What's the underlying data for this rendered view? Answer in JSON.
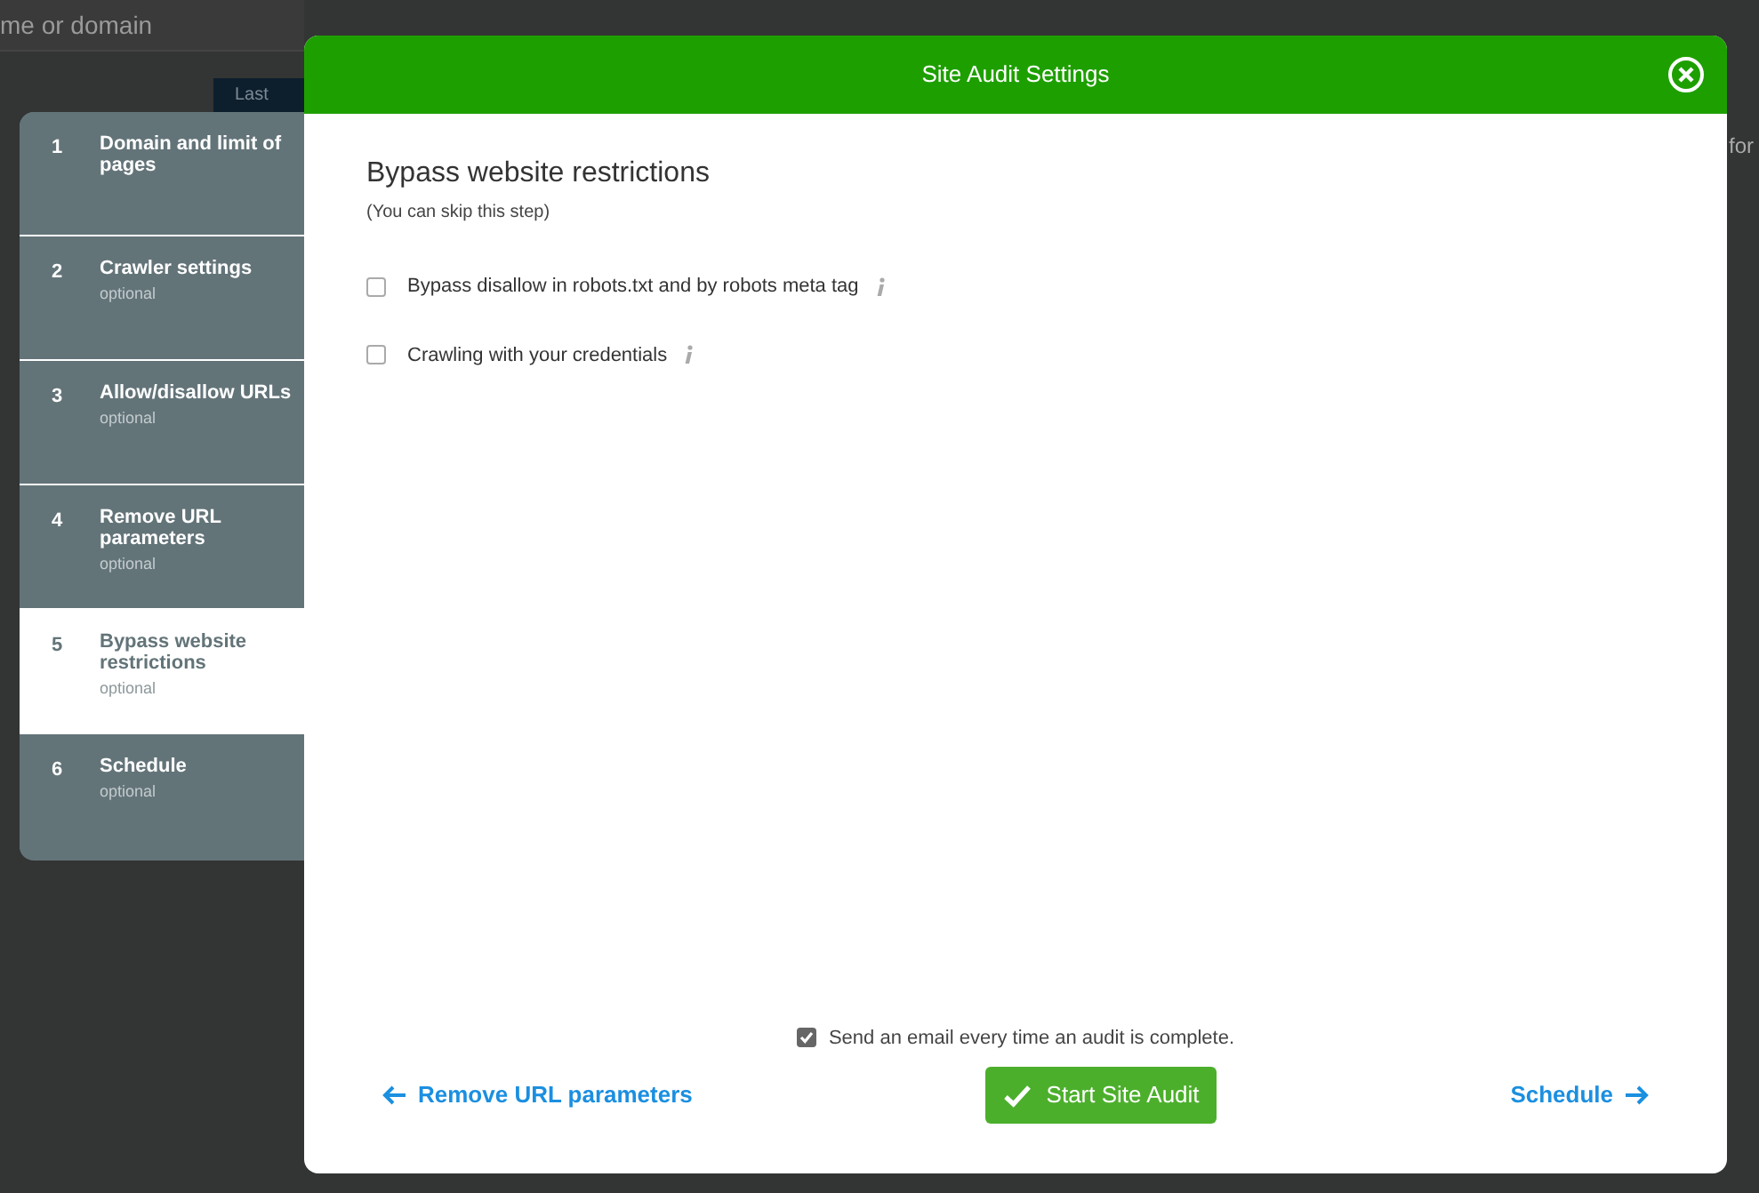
{
  "background": {
    "search_text": "me or domain",
    "button": "Last",
    "right_text": "for"
  },
  "steps": [
    {
      "number": "1",
      "title": "Domain and limit of pages",
      "selected": false
    },
    {
      "number": "2",
      "title": "Crawler settings",
      "note": "optional",
      "selected": false
    },
    {
      "number": "3",
      "title": "Allow/disallow URLs",
      "note": "optional",
      "selected": false
    },
    {
      "number": "4",
      "title": "Remove URL parameters",
      "note": "optional",
      "selected": false
    },
    {
      "number": "5",
      "title": "Bypass website restrictions",
      "note": "optional",
      "selected": true
    },
    {
      "number": "6",
      "title": "Schedule",
      "note": "optional",
      "selected": false
    }
  ],
  "dialog": {
    "title": "Site Audit Settings",
    "heading": "Bypass website restrictions",
    "subheading": "(You can skip this step)",
    "options": [
      {
        "label": "Bypass disallow in robots.txt and by robots meta tag",
        "checked": false
      },
      {
        "label": "Crawling with your credentials",
        "checked": false
      }
    ],
    "email": {
      "label": "Send an email every time an audit is complete.",
      "checked": true
    },
    "back": "Remove URL parameters",
    "start": "Start Site Audit",
    "next": "Schedule"
  }
}
